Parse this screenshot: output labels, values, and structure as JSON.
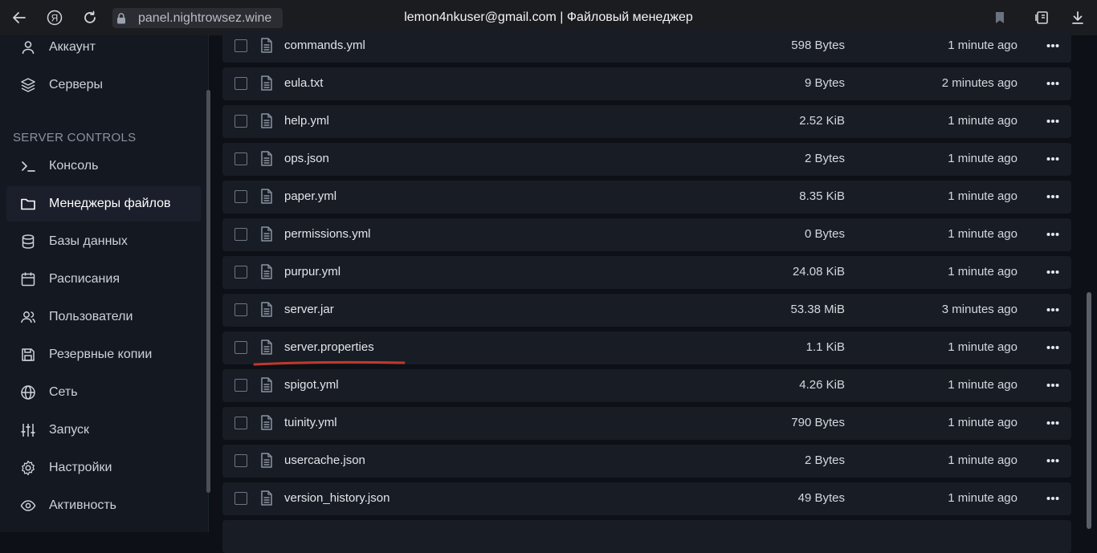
{
  "browser": {
    "url": "panel.nightrowsez.wine",
    "title": "lemon4nkuser@gmail.com | Файловый менеджер"
  },
  "sidebar": {
    "section_label": "SERVER CONTROLS",
    "items": [
      {
        "label": "Аккаунт",
        "icon": "user-icon"
      },
      {
        "label": "Серверы",
        "icon": "layers-icon"
      },
      {
        "label": "Консоль",
        "icon": "terminal-icon"
      },
      {
        "label": "Менеджеры файлов",
        "icon": "folder-icon",
        "active": true
      },
      {
        "label": "Базы данных",
        "icon": "database-icon"
      },
      {
        "label": "Расписания",
        "icon": "calendar-icon"
      },
      {
        "label": "Пользователи",
        "icon": "users-icon"
      },
      {
        "label": "Резервные копии",
        "icon": "save-icon"
      },
      {
        "label": "Сеть",
        "icon": "globe-icon"
      },
      {
        "label": "Запуск",
        "icon": "sliders-icon"
      },
      {
        "label": "Настройки",
        "icon": "gear-icon"
      },
      {
        "label": "Активность",
        "icon": "eye-icon"
      }
    ]
  },
  "files": [
    {
      "name": "commands.yml",
      "size": "598 Bytes",
      "modified": "1 minute ago"
    },
    {
      "name": "eula.txt",
      "size": "9 Bytes",
      "modified": "2 minutes ago"
    },
    {
      "name": "help.yml",
      "size": "2.52 KiB",
      "modified": "1 minute ago"
    },
    {
      "name": "ops.json",
      "size": "2 Bytes",
      "modified": "1 minute ago"
    },
    {
      "name": "paper.yml",
      "size": "8.35 KiB",
      "modified": "1 minute ago"
    },
    {
      "name": "permissions.yml",
      "size": "0 Bytes",
      "modified": "1 minute ago"
    },
    {
      "name": "purpur.yml",
      "size": "24.08 KiB",
      "modified": "1 minute ago"
    },
    {
      "name": "server.jar",
      "size": "53.38 MiB",
      "modified": "3 minutes ago"
    },
    {
      "name": "server.properties",
      "size": "1.1 KiB",
      "modified": "1 minute ago"
    },
    {
      "name": "spigot.yml",
      "size": "4.26 KiB",
      "modified": "1 minute ago"
    },
    {
      "name": "tuinity.yml",
      "size": "790 Bytes",
      "modified": "1 minute ago"
    },
    {
      "name": "usercache.json",
      "size": "2 Bytes",
      "modified": "1 minute ago"
    },
    {
      "name": "version_history.json",
      "size": "49 Bytes",
      "modified": "1 minute ago"
    }
  ],
  "colors": {
    "accent_underline": "#c0392b",
    "row_bg": "#181c24",
    "sidebar_bg": "#141820"
  }
}
